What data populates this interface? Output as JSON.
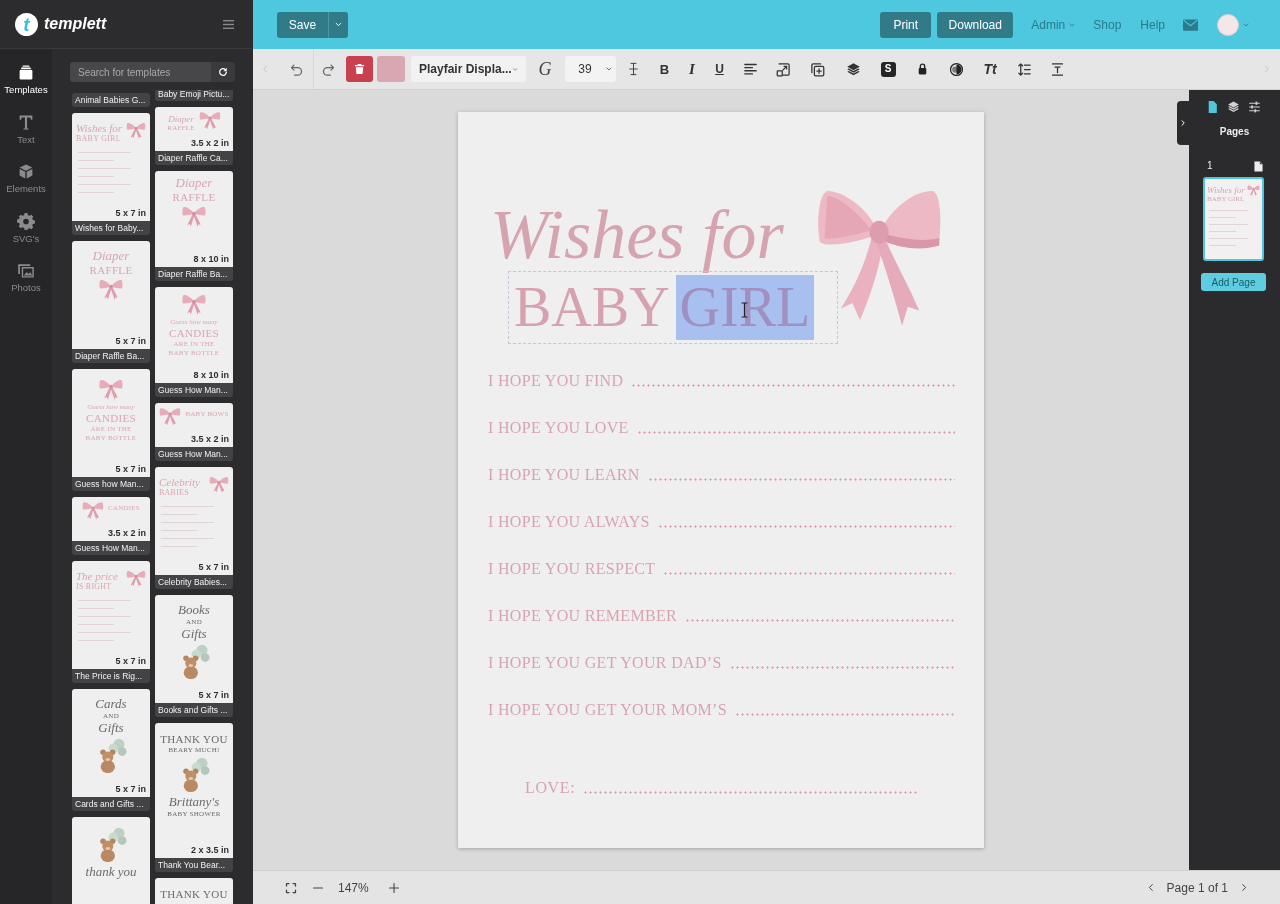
{
  "sidebar": {
    "logo_mark": "t",
    "logo_text": "templett",
    "rail": [
      {
        "label": "Templates",
        "selected": true
      },
      {
        "label": "Text",
        "selected": false
      },
      {
        "label": "Elements",
        "selected": false
      },
      {
        "label": "SVG's",
        "selected": false
      },
      {
        "label": "Photos",
        "selected": false
      }
    ],
    "search": {
      "placeholder": "Search for templates"
    },
    "template_columns": [
      [
        {
          "title": "Animal Babies G..."
        },
        {
          "title": "Wishes for Baby...",
          "size": "5 x 7 in",
          "kind": "portrait",
          "blocks": [
            {
              "kind": "script",
              "text": "Wishes for"
            },
            {
              "kind": "caps",
              "text": "BABY GIRL"
            },
            {
              "kind": "bow"
            },
            {
              "kind": "rules"
            }
          ]
        },
        {
          "title": "Diaper Raffle Ba...",
          "size": "5 x 7 in",
          "kind": "portrait",
          "blocks": [
            {
              "kind": "script",
              "text": "Diaper"
            },
            {
              "kind": "caps",
              "text": "RAFFLE"
            },
            {
              "kind": "bow"
            }
          ]
        },
        {
          "title": "Guess how Man...",
          "size": "5 x 7 in",
          "kind": "portrait",
          "blocks": [
            {
              "kind": "bow"
            },
            {
              "kind": "note",
              "text": "Guess how many"
            },
            {
              "kind": "caps",
              "text": "CANDIES"
            },
            {
              "kind": "small",
              "text": "ARE IN THE"
            },
            {
              "kind": "small",
              "text": "BABY BOTTLE"
            }
          ]
        },
        {
          "title": "Guess How Man...",
          "size": "3.5 x 2 in",
          "kind": "wide",
          "blocks": [
            {
              "kind": "bow"
            },
            {
              "kind": "caps",
              "text": "CANDIES"
            }
          ]
        },
        {
          "title": "The Price is Rig...",
          "size": "5 x 7 in",
          "kind": "portrait",
          "blocks": [
            {
              "kind": "script",
              "text": "The price"
            },
            {
              "kind": "caps",
              "text": "IS RIGHT"
            },
            {
              "kind": "bow"
            },
            {
              "kind": "rules"
            }
          ]
        },
        {
          "title": "Cards and Gifts ...",
          "size": "5 x 7 in",
          "kind": "portrait",
          "blocks": [
            {
              "kind": "script",
              "text": "Cards"
            },
            {
              "kind": "small",
              "text": "AND"
            },
            {
              "kind": "script",
              "text": "Gifts"
            },
            {
              "kind": "bear"
            }
          ]
        },
        {
          "kind": "portrait",
          "blocks": [
            {
              "kind": "bear"
            },
            {
              "kind": "script",
              "text": "thank you"
            }
          ]
        }
      ],
      [
        {
          "title": "Baby Emoji Pictu..."
        },
        {
          "title": "Diaper Raffle Ca...",
          "size": "3.5 x 2 in",
          "kind": "wide",
          "blocks": [
            {
              "kind": "script",
              "text": "Diaper"
            },
            {
              "kind": "caps",
              "text": "RAFFLE"
            },
            {
              "kind": "bow"
            }
          ]
        },
        {
          "title": "Diaper Raffle Ba...",
          "size": "8 x 10 in",
          "kind": "poster",
          "blocks": [
            {
              "kind": "script",
              "text": "Diaper"
            },
            {
              "kind": "caps",
              "text": "RAFFLE"
            },
            {
              "kind": "bow"
            }
          ]
        },
        {
          "title": "Guess How Man...",
          "size": "8 x 10 in",
          "kind": "poster",
          "blocks": [
            {
              "kind": "bow"
            },
            {
              "kind": "note",
              "text": "Guess how many"
            },
            {
              "kind": "caps",
              "text": "CANDIES"
            },
            {
              "kind": "small",
              "text": "ARE IN THE"
            },
            {
              "kind": "small",
              "text": "BABY BOTTLE"
            }
          ]
        },
        {
          "title": "Guess How Man...",
          "size": "3.5 x 2 in",
          "kind": "wide",
          "blocks": [
            {
              "kind": "bow"
            },
            {
              "kind": "caps",
              "text": "BABY BOWS"
            }
          ]
        },
        {
          "title": "Celebrity Babies...",
          "size": "5 x 7 in",
          "kind": "portrait",
          "blocks": [
            {
              "kind": "script",
              "text": "Celebrity"
            },
            {
              "kind": "caps",
              "text": "BABIES"
            },
            {
              "kind": "bow"
            },
            {
              "kind": "rules"
            }
          ]
        },
        {
          "title": "Books and Gifts ...",
          "size": "5 x 7 in",
          "kind": "portrait",
          "blocks": [
            {
              "kind": "script",
              "text": "Books"
            },
            {
              "kind": "small",
              "text": "AND"
            },
            {
              "kind": "script",
              "text": "Gifts"
            },
            {
              "kind": "bear"
            }
          ]
        },
        {
          "title": "Thank You Bear...",
          "size": "2 x 3.5 in",
          "kind": "tall",
          "blocks": [
            {
              "kind": "caps",
              "text": "THANK YOU"
            },
            {
              "kind": "small",
              "text": "BEARY MUCH!"
            },
            {
              "kind": "bear"
            },
            {
              "kind": "script",
              "text": "Brittany's"
            },
            {
              "kind": "small",
              "text": "BABY SHOWER"
            }
          ]
        },
        {
          "kind": "tall",
          "blocks": [
            {
              "kind": "caps",
              "text": "THANK YOU"
            }
          ]
        }
      ]
    ]
  },
  "header": {
    "save_button": "Save",
    "print_button": "Print",
    "download_button": "Download",
    "nav": [
      {
        "label": "Admin",
        "has_menu": true
      },
      {
        "label": "Shop",
        "has_menu": false
      },
      {
        "label": "Help",
        "has_menu": false
      }
    ]
  },
  "toolbar": {
    "font_family": "Playfair Displa...",
    "font_size": "39",
    "text_buttons": [
      "G",
      "B",
      "I",
      "U",
      "S",
      "Tt"
    ]
  },
  "design": {
    "script_heading": "Wishes for",
    "title_segments": [
      {
        "text": "BABY",
        "selected": false
      },
      {
        "text": "GIRL",
        "selected": true
      }
    ],
    "prompts": [
      "I HOPE YOU FIND",
      "I HOPE YOU LOVE",
      "I HOPE YOU LEARN",
      "I HOPE YOU ALWAYS",
      "I HOPE YOU RESPECT",
      "I HOPE YOU REMEMBER",
      "I HOPE YOU GET YOUR DAD’S",
      "I HOPE YOU GET YOUR MOM’S"
    ],
    "signature": "LOVE:"
  },
  "pages_panel": {
    "tabs": [
      {
        "selected": true
      },
      {
        "selected": false
      },
      {
        "selected": false
      }
    ],
    "title": "Pages",
    "pages": [
      {
        "number": "1",
        "selected": true,
        "preview": {
          "blocks": [
            {
              "kind": "script",
              "text": "Wishes for"
            },
            {
              "kind": "caps",
              "text": "BABY GIRL"
            },
            {
              "kind": "bow"
            },
            {
              "kind": "rules"
            }
          ]
        }
      }
    ],
    "add_page_button": "Add Page"
  },
  "status_bar": {
    "zoom": "147%",
    "page_indicator": "Page 1 of 1"
  }
}
